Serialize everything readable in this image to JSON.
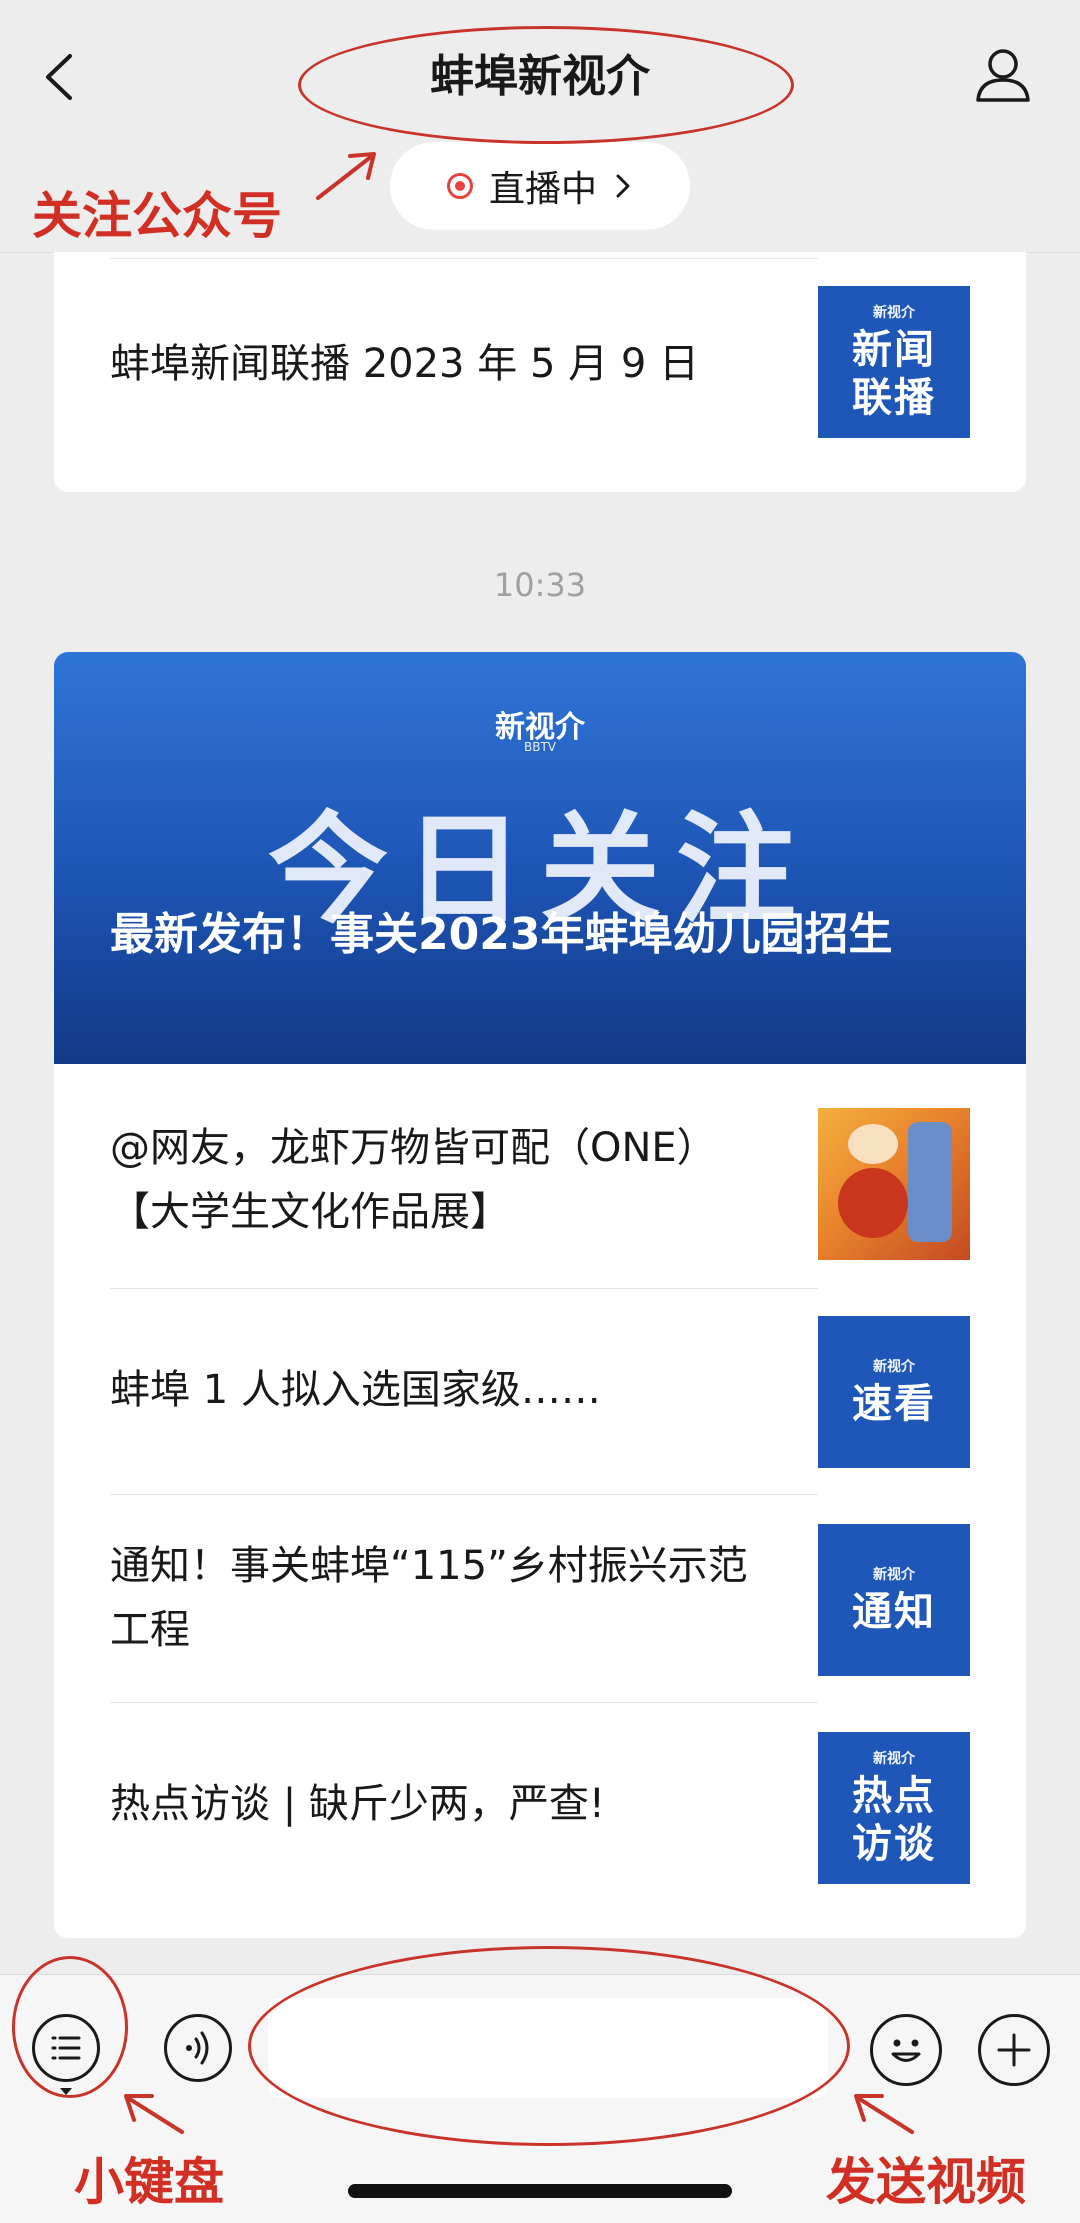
{
  "header": {
    "title": "蚌埠新视介",
    "live_label": "直播中"
  },
  "card1": {
    "item_title": "蚌埠新闻联播 2023 年 5 月 9 日",
    "thumb_brand": "新视介",
    "thumb_text": "新闻\n联播"
  },
  "timestamp": "10:33",
  "card2": {
    "banner_brand": "新视介",
    "banner_brand_sub": "BBTV",
    "banner_big": "今日关注",
    "banner_caption": "最新发布！事关2023年蚌埠幼儿园招生",
    "items": [
      {
        "title": "@网友，龙虾万物皆可配（ONE）【大学生文化作品展】"
      },
      {
        "title": "蚌埠 1 人拟入选国家级……",
        "thumb_brand": "新视介",
        "thumb_text": "速看"
      },
      {
        "title": "通知！事关蚌埠“115”乡村振兴示范工程",
        "thumb_brand": "新视介",
        "thumb_text": "通知"
      },
      {
        "title": "热点访谈 | 缺斤少两，严查!",
        "thumb_brand": "新视介",
        "thumb_text": "热点\n访谈"
      }
    ]
  },
  "annotations": {
    "follow": "关注公众号",
    "keyboard": "小键盘",
    "send_video": "发送视频",
    "color": "#d22f24"
  },
  "colors": {
    "background": "#ededed",
    "live_red": "#e64340",
    "thumb_blue": "#1e57b8"
  }
}
